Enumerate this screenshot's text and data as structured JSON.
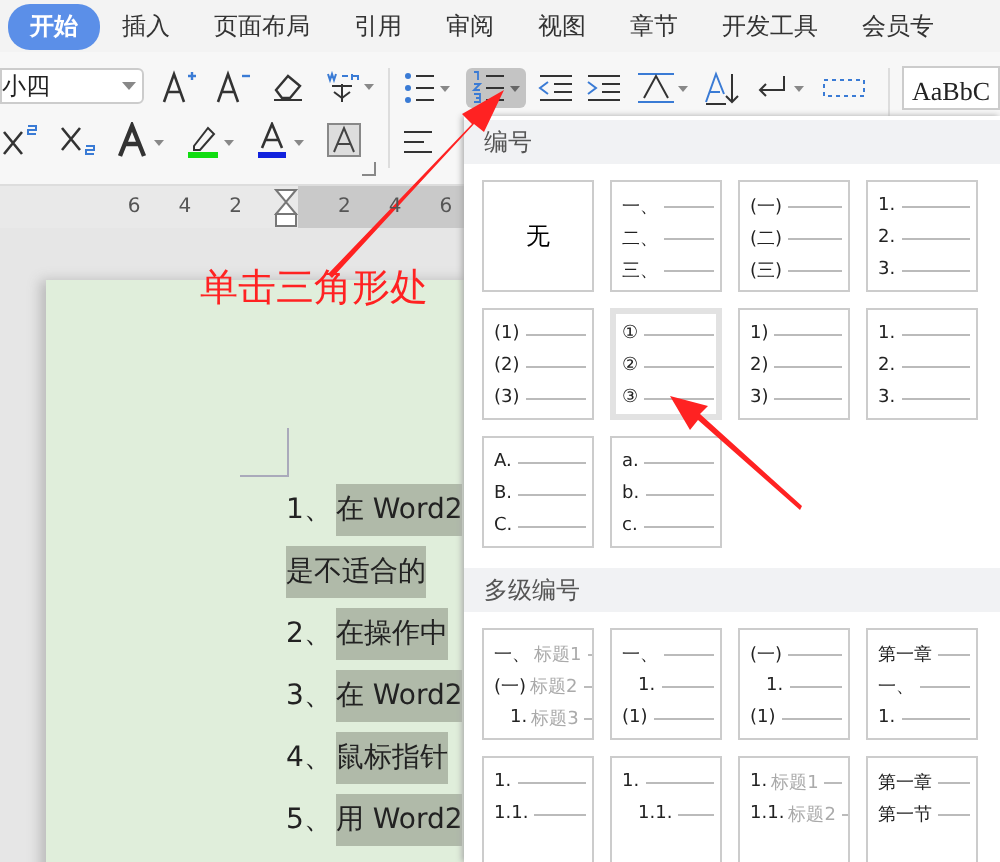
{
  "tabs": [
    {
      "label": "开始",
      "selected": true
    },
    {
      "label": "插入",
      "selected": false
    },
    {
      "label": "页面布局",
      "selected": false
    },
    {
      "label": "引用",
      "selected": false
    },
    {
      "label": "审阅",
      "selected": false
    },
    {
      "label": "视图",
      "selected": false
    },
    {
      "label": "章节",
      "selected": false
    },
    {
      "label": "开发工具",
      "selected": false
    },
    {
      "label": "会员专",
      "selected": false
    }
  ],
  "toolbar": {
    "font_size": {
      "value": "小四"
    },
    "numbering_button": {
      "pressed": true
    },
    "style_preview": {
      "text": "AaBbC"
    }
  },
  "ruler": {
    "left_ticks": [
      "6",
      "4",
      "2"
    ],
    "right_ticks": [
      "2",
      "4",
      "6"
    ]
  },
  "document": {
    "lines": [
      {
        "marker": "1、",
        "text": "在 Word2",
        "selected": true
      },
      {
        "text": "是不适合的",
        "selected": true
      },
      {
        "marker": "2、",
        "text": "在操作中",
        "selected": true
      },
      {
        "marker": "3、",
        "text": "在 Word2",
        "selected": true
      },
      {
        "marker": "4、",
        "text": "鼠标指针",
        "selected": true
      },
      {
        "marker": "5、",
        "text": "用 Word2",
        "selected": true
      }
    ]
  },
  "callout": {
    "text": "单击三角形处"
  },
  "numbering_menu": {
    "sections": [
      {
        "title": "编号",
        "tiles": [
          {
            "kind": "none",
            "label": "无",
            "selected": false
          },
          {
            "kind": "list",
            "selected": false,
            "items": [
              {
                "label": "一、",
                "kind": "top"
              },
              {
                "label": "二、",
                "kind": "top"
              },
              {
                "label": "三、",
                "kind": "top"
              }
            ]
          },
          {
            "kind": "list",
            "selected": false,
            "items": [
              {
                "label": "(一)",
                "kind": "top"
              },
              {
                "label": "(二)",
                "kind": "top"
              },
              {
                "label": "(三)",
                "kind": "top"
              }
            ]
          },
          {
            "kind": "list",
            "selected": false,
            "items": [
              {
                "label": "1.",
                "kind": "top"
              },
              {
                "label": "2.",
                "kind": "top"
              },
              {
                "label": "3.",
                "kind": "top"
              }
            ]
          },
          {
            "kind": "list",
            "selected": false,
            "items": [
              {
                "label": "(1)",
                "kind": "top"
              },
              {
                "label": "(2)",
                "kind": "top"
              },
              {
                "label": "(3)",
                "kind": "top"
              }
            ]
          },
          {
            "kind": "list",
            "selected": true,
            "items": [
              {
                "label": "①",
                "kind": "top"
              },
              {
                "label": "②",
                "kind": "top"
              },
              {
                "label": "③",
                "kind": "top"
              }
            ]
          },
          {
            "kind": "list",
            "selected": false,
            "items": [
              {
                "label": "1)",
                "kind": "top"
              },
              {
                "label": "2)",
                "kind": "top"
              },
              {
                "label": "3)",
                "kind": "top"
              }
            ]
          },
          {
            "kind": "list",
            "selected": false,
            "items": [
              {
                "label": "1.",
                "kind": "top"
              },
              {
                "label": "2.",
                "kind": "top"
              },
              {
                "label": "3.",
                "kind": "top"
              }
            ]
          },
          {
            "kind": "list",
            "selected": false,
            "items": [
              {
                "label": "A.",
                "kind": "top"
              },
              {
                "label": "B.",
                "kind": "top"
              },
              {
                "label": "C.",
                "kind": "top"
              }
            ]
          },
          {
            "kind": "list",
            "selected": false,
            "items": [
              {
                "label": "a.",
                "kind": "top"
              },
              {
                "label": "b.",
                "kind": "top"
              },
              {
                "label": "c.",
                "kind": "top"
              }
            ]
          }
        ]
      },
      {
        "title": "多级编号",
        "tiles": [
          {
            "kind": "list",
            "selected": false,
            "items": [
              {
                "label": "一、",
                "caption": "标题1",
                "kind": "top"
              },
              {
                "label": "(一)",
                "caption": "标题2",
                "kind": "top"
              },
              {
                "label": "1.",
                "caption": "标题3",
                "kind": "sub"
              }
            ]
          },
          {
            "kind": "list",
            "selected": false,
            "items": [
              {
                "label": "一、",
                "kind": "top"
              },
              {
                "label": "1.",
                "kind": "sub"
              },
              {
                "label": "(1)",
                "kind": "top"
              }
            ]
          },
          {
            "kind": "list",
            "selected": false,
            "items": [
              {
                "label": "(一)",
                "kind": "top"
              },
              {
                "label": "1.",
                "kind": "sub"
              },
              {
                "label": "(1)",
                "kind": "top"
              }
            ]
          },
          {
            "kind": "list",
            "selected": false,
            "items": [
              {
                "label": "第一章",
                "kind": "top"
              },
              {
                "label": "一、",
                "kind": "top"
              },
              {
                "label": "1.",
                "kind": "top"
              }
            ]
          },
          {
            "kind": "list",
            "selected": false,
            "items": [
              {
                "label": "1.",
                "kind": "top"
              },
              {
                "label": "1.1.",
                "kind": "top"
              }
            ]
          },
          {
            "kind": "list",
            "selected": false,
            "items": [
              {
                "label": "1.",
                "kind": "top"
              },
              {
                "label": "1.1.",
                "kind": "sub"
              }
            ]
          },
          {
            "kind": "list",
            "selected": false,
            "items": [
              {
                "label": "1.",
                "caption": "标题1",
                "kind": "top"
              },
              {
                "label": "1.1.",
                "caption": "标题2",
                "kind": "top"
              }
            ]
          },
          {
            "kind": "list",
            "selected": false,
            "items": [
              {
                "label": "第一章",
                "kind": "top"
              },
              {
                "label": "第一节",
                "kind": "top"
              }
            ]
          }
        ]
      }
    ]
  }
}
